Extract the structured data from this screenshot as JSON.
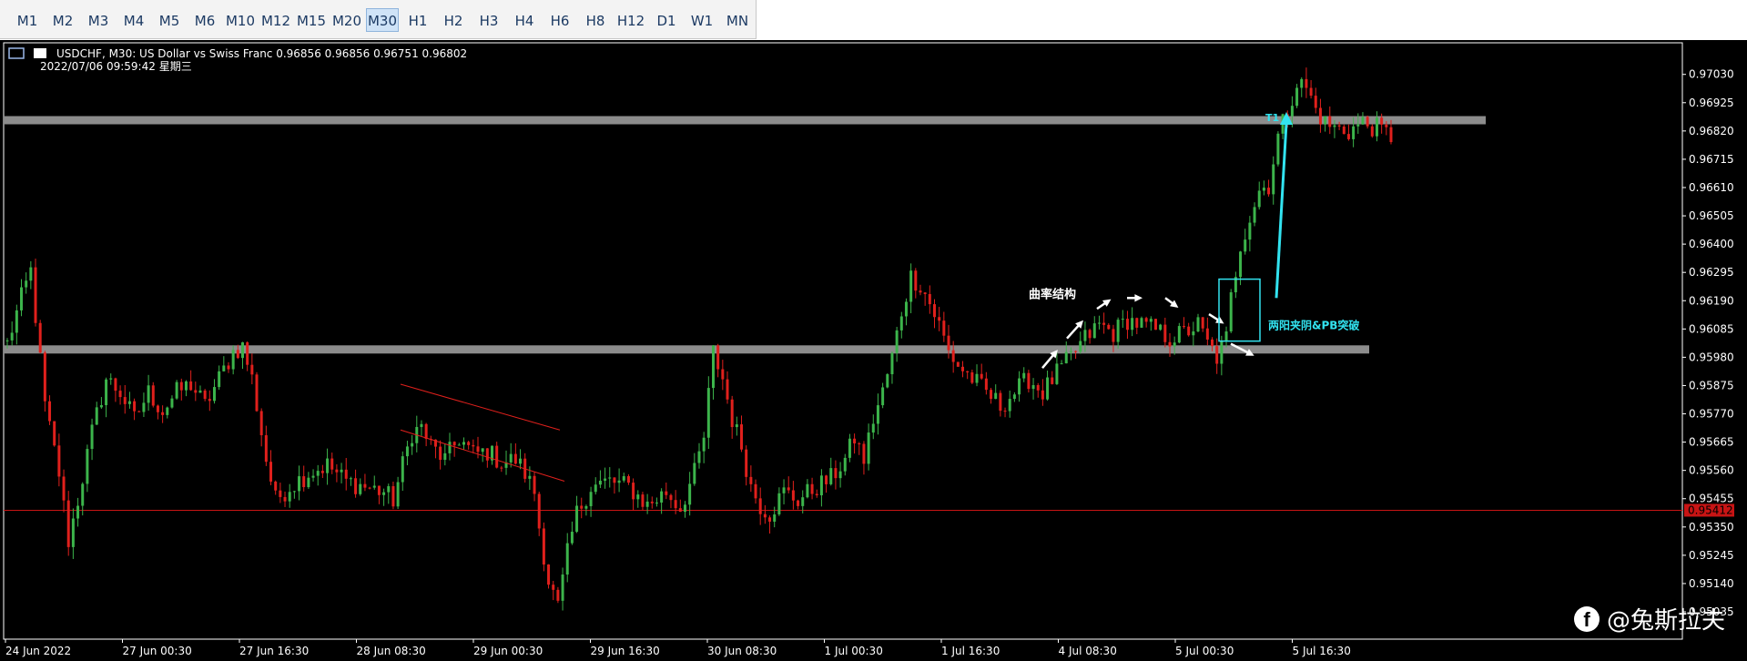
{
  "toolbar": {
    "timeframes": [
      "M1",
      "M2",
      "M3",
      "M4",
      "M5",
      "M6",
      "M10",
      "M12",
      "M15",
      "M20",
      "M30",
      "H1",
      "H2",
      "H3",
      "H4",
      "H6",
      "H8",
      "H12",
      "D1",
      "W1",
      "MN"
    ],
    "active": "M30"
  },
  "header": {
    "line1": "USDCHF, M30:  US Dollar vs Swiss Franc  0.96856 0.96856 0.96751 0.96802",
    "line2": "2022/07/06  09:59:42  星期三"
  },
  "colors": {
    "background": "#000000",
    "bull": "#3cb44b",
    "bear": "#e0201c",
    "zone": "#8c8c8c",
    "annotation_cyan": "#32e3f0",
    "annotation_white": "#ffffff",
    "current_price_line": "#c81414",
    "axis": "#ffffff"
  },
  "chart_data": {
    "type": "candlestick",
    "symbol": "USDCHF",
    "timeframe": "M30",
    "ylim": [
      0.95035,
      0.971
    ],
    "y_ticks": [
      "0.97030",
      "0.96925",
      "0.96820",
      "0.96715",
      "0.96610",
      "0.96505",
      "0.96400",
      "0.96295",
      "0.96190",
      "0.96085",
      "0.95980",
      "0.95875",
      "0.95770",
      "0.95665",
      "0.95560",
      "0.95455",
      "0.95350",
      "0.95245",
      "0.95140",
      "0.95035"
    ],
    "x_labels": [
      "24 Jun 2022",
      "27 Jun 00:30",
      "27 Jun 16:30",
      "28 Jun 08:30",
      "29 Jun 00:30",
      "29 Jun 16:30",
      "30 Jun 08:30",
      "1 Jul 00:30",
      "1 Jul 16:30",
      "4 Jul 08:30",
      "5 Jul 00:30",
      "5 Jul 16:30"
    ],
    "current_price": "0.95412",
    "series_close_path": [
      [
        0,
        0.9603
      ],
      [
        3,
        0.962
      ],
      [
        5,
        0.963
      ],
      [
        8,
        0.958
      ],
      [
        11,
        0.9555
      ],
      [
        13,
        0.953
      ],
      [
        15,
        0.9545
      ],
      [
        18,
        0.957
      ],
      [
        21,
        0.959
      ],
      [
        24,
        0.9585
      ],
      [
        27,
        0.9575
      ],
      [
        30,
        0.9585
      ],
      [
        33,
        0.9578
      ],
      [
        36,
        0.9585
      ],
      [
        39,
        0.9588
      ],
      [
        42,
        0.958
      ],
      [
        45,
        0.959
      ],
      [
        48,
        0.96
      ],
      [
        50,
        0.9602
      ],
      [
        52,
        0.959
      ],
      [
        55,
        0.956
      ],
      [
        57,
        0.9545
      ],
      [
        60,
        0.955
      ],
      [
        64,
        0.9555
      ],
      [
        68,
        0.9558
      ],
      [
        72,
        0.9552
      ],
      [
        76,
        0.955
      ],
      [
        80,
        0.9548
      ],
      [
        82,
        0.9545
      ],
      [
        84,
        0.9558
      ],
      [
        86,
        0.957
      ],
      [
        88,
        0.9572
      ],
      [
        90,
        0.9565
      ],
      [
        93,
        0.956
      ],
      [
        96,
        0.9568
      ],
      [
        99,
        0.9562
      ],
      [
        102,
        0.9563
      ],
      [
        105,
        0.9559
      ],
      [
        108,
        0.956
      ],
      [
        110,
        0.9555
      ],
      [
        112,
        0.9548
      ],
      [
        113,
        0.9535
      ],
      [
        115,
        0.9515
      ],
      [
        117,
        0.9505
      ],
      [
        119,
        0.9525
      ],
      [
        121,
        0.954
      ],
      [
        124,
        0.955
      ],
      [
        128,
        0.9552
      ],
      [
        132,
        0.955
      ],
      [
        136,
        0.9543
      ],
      [
        140,
        0.9548
      ],
      [
        143,
        0.9542
      ],
      [
        146,
        0.9555
      ],
      [
        148,
        0.9568
      ],
      [
        150,
        0.96
      ],
      [
        152,
        0.959
      ],
      [
        154,
        0.9575
      ],
      [
        156,
        0.9565
      ],
      [
        158,
        0.955
      ],
      [
        160,
        0.9543
      ],
      [
        162,
        0.954
      ],
      [
        165,
        0.9548
      ],
      [
        168,
        0.9545
      ],
      [
        172,
        0.955
      ],
      [
        175,
        0.9553
      ],
      [
        178,
        0.956
      ],
      [
        180,
        0.9568
      ],
      [
        182,
        0.956
      ],
      [
        184,
        0.9575
      ],
      [
        186,
        0.9585
      ],
      [
        188,
        0.9598
      ],
      [
        190,
        0.9615
      ],
      [
        192,
        0.9628
      ],
      [
        194,
        0.9625
      ],
      [
        196,
        0.9618
      ],
      [
        198,
        0.961
      ],
      [
        200,
        0.96
      ],
      [
        202,
        0.9595
      ],
      [
        205,
        0.959
      ],
      [
        208,
        0.9585
      ],
      [
        211,
        0.958
      ],
      [
        214,
        0.9585
      ],
      [
        217,
        0.959
      ],
      [
        220,
        0.9585
      ],
      [
        223,
        0.9592
      ],
      [
        226,
        0.9598
      ],
      [
        229,
        0.9605
      ],
      [
        232,
        0.961
      ],
      [
        235,
        0.9607
      ],
      [
        238,
        0.9612
      ],
      [
        241,
        0.961
      ],
      [
        244,
        0.9608
      ],
      [
        247,
        0.9605
      ],
      [
        250,
        0.9607
      ],
      [
        253,
        0.961
      ],
      [
        255,
        0.9603
      ],
      [
        257,
        0.9598
      ],
      [
        259,
        0.9605
      ],
      [
        260,
        0.962
      ],
      [
        262,
        0.964
      ],
      [
        264,
        0.965
      ],
      [
        266,
        0.966
      ],
      [
        268,
        0.9662
      ],
      [
        270,
        0.968
      ],
      [
        272,
        0.969
      ],
      [
        274,
        0.97
      ],
      [
        276,
        0.9698
      ],
      [
        278,
        0.969
      ],
      [
        280,
        0.9685
      ],
      [
        282,
        0.9683
      ],
      [
        285,
        0.9682
      ],
      [
        288,
        0.9685
      ],
      [
        291,
        0.9683
      ],
      [
        294,
        0.968
      ]
    ],
    "zones": [
      {
        "price": 0.9686,
        "x_end": 1632
      },
      {
        "price": 0.96009,
        "x_end": 1504
      }
    ],
    "annotations": {
      "curve_label": "曲率结构",
      "breakout_label": "两阳夹阴&PB突破",
      "target_label": "T1"
    }
  },
  "watermark": {
    "text": "@兔斯拉夫",
    "icon": "facebook-icon"
  }
}
